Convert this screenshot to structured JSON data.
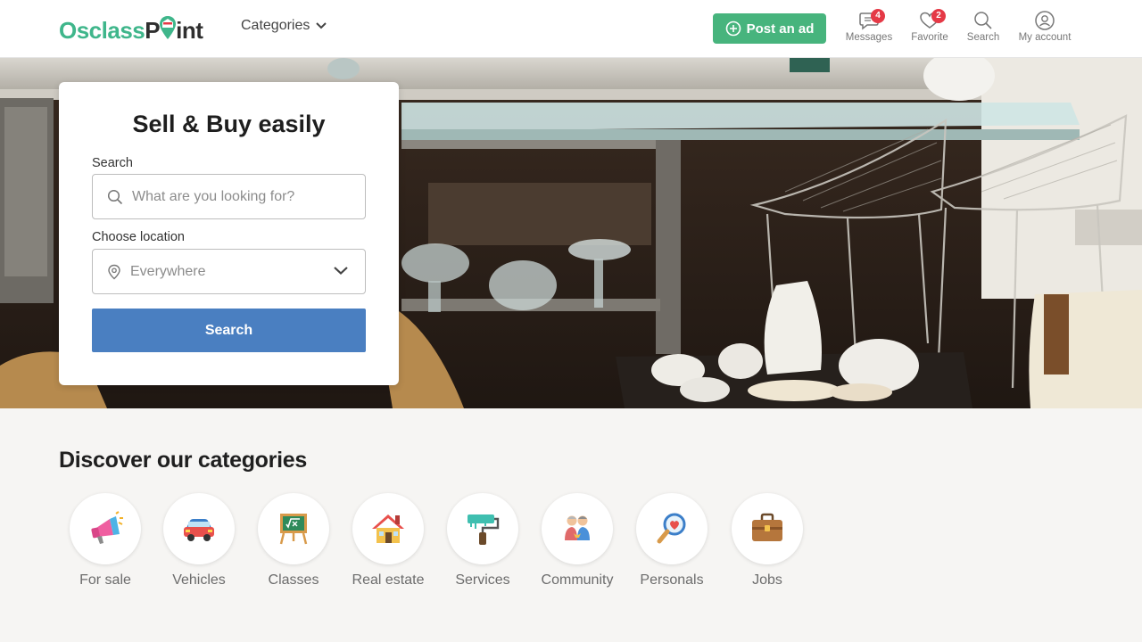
{
  "header": {
    "logo_text_1": "Osclass",
    "logo_text_2": "P",
    "logo_text_3": "int",
    "categories_label": "Categories",
    "post_ad_label": "Post an ad",
    "icons": [
      {
        "label": "Messages",
        "icon": "chat-bubble-icon",
        "badge": "4"
      },
      {
        "label": "Favorite",
        "icon": "heart-icon",
        "badge": "2"
      },
      {
        "label": "Search",
        "icon": "search-icon",
        "badge": null
      },
      {
        "label": "My account",
        "icon": "user-icon",
        "badge": null
      }
    ]
  },
  "hero": {
    "title": "Sell & Buy easily",
    "search_label": "Search",
    "search_placeholder": "What are you looking for?",
    "location_label": "Choose location",
    "location_value": "Everywhere",
    "search_button": "Search"
  },
  "categories": {
    "title": "Discover our categories",
    "items": [
      {
        "label": "For sale",
        "icon": "megaphone-icon"
      },
      {
        "label": "Vehicles",
        "icon": "car-icon"
      },
      {
        "label": "Classes",
        "icon": "chalkboard-icon"
      },
      {
        "label": "Real estate",
        "icon": "house-icon"
      },
      {
        "label": "Services",
        "icon": "paint-roller-icon"
      },
      {
        "label": "Community",
        "icon": "people-icon"
      },
      {
        "label": "Personals",
        "icon": "magnifier-heart-icon"
      },
      {
        "label": "Jobs",
        "icon": "briefcase-icon"
      }
    ]
  },
  "colors": {
    "brand_green": "#47b47d",
    "search_blue": "#4a7fc1",
    "badge_red": "#e53946"
  }
}
